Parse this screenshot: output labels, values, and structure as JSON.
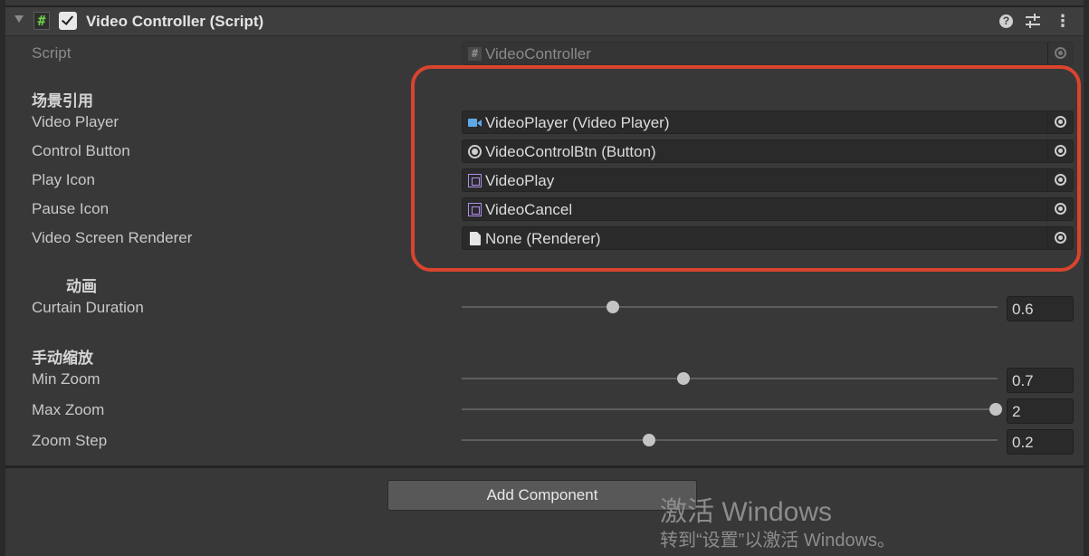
{
  "header": {
    "title": "Video Controller (Script)",
    "help_glyph": "?",
    "menu_glyph": "⋮",
    "script_glyph": "#"
  },
  "script_row": {
    "label": "Script",
    "value": "VideoController"
  },
  "sections": {
    "scene_refs": "场景引用",
    "animation": "动画",
    "manual_zoom": "手动缩放"
  },
  "fields": [
    {
      "label": "Video Player",
      "value": "VideoPlayer (Video Player)",
      "icon": "video-player-icon"
    },
    {
      "label": "Control Button",
      "value": "VideoControlBtn (Button)",
      "icon": "button-icon"
    },
    {
      "label": "Play Icon",
      "value": "VideoPlay",
      "icon": "rect-transform-icon"
    },
    {
      "label": "Pause Icon",
      "value": "VideoCancel",
      "icon": "rect-transform-icon"
    },
    {
      "label": "Video Screen Renderer",
      "value": "None (Renderer)",
      "icon": "file-icon"
    }
  ],
  "sliders": [
    {
      "label": "Curtain Duration",
      "value": "0.6",
      "position": 0.27
    },
    {
      "label": "Min Zoom",
      "value": "0.7",
      "position": 0.405
    },
    {
      "label": "Max Zoom",
      "value": "2",
      "position": 1.0
    },
    {
      "label": "Zoom Step",
      "value": "0.2",
      "position": 0.34
    }
  ],
  "add_component": "Add Component",
  "watermark": {
    "line1": "激活 Windows",
    "line2": "转到“设置”以激活 Windows。"
  },
  "colors": {
    "highlight": "#d9442f",
    "background": "#383838"
  }
}
